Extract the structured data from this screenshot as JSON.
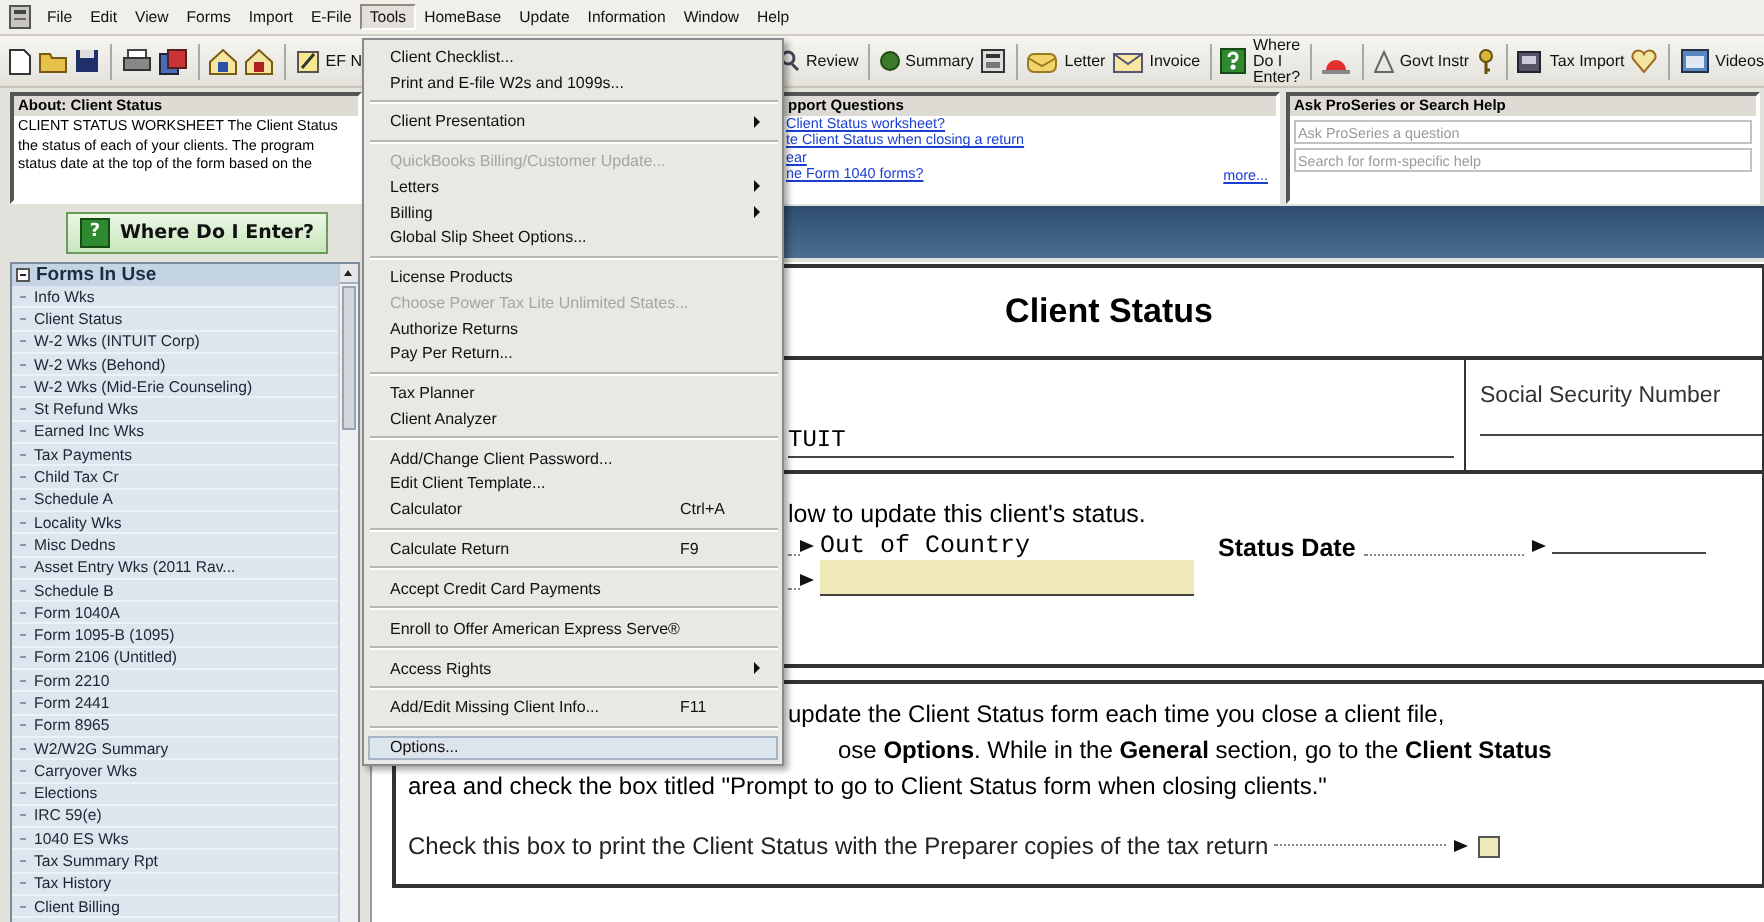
{
  "menu_bar": {
    "items": [
      {
        "label": "File",
        "selected": false
      },
      {
        "label": "Edit",
        "selected": false
      },
      {
        "label": "View",
        "selected": false
      },
      {
        "label": "Forms",
        "selected": false
      },
      {
        "label": "Import",
        "selected": false
      },
      {
        "label": "E-File",
        "selected": false
      },
      {
        "label": "Tools",
        "selected": true
      },
      {
        "label": "HomeBase",
        "selected": false
      },
      {
        "label": "Update",
        "selected": false
      },
      {
        "label": "Information",
        "selected": false
      },
      {
        "label": "Window",
        "selected": false
      },
      {
        "label": "Help",
        "selected": false
      }
    ]
  },
  "toolbar": {
    "buttons": [
      "EF N",
      "Review",
      "Summary",
      "Letter",
      "Invoice",
      "Where Do I Enter?",
      "Govt Instr",
      "Tax Import",
      "Videos"
    ]
  },
  "about_panel": {
    "title": "About: Client Status",
    "lines": [
      "CLIENT STATUS WORKSHEET The Client Status",
      "the status of each of your clients.  The program",
      "status date at the top of the form based on the"
    ]
  },
  "support_panel": {
    "title": "pport Questions",
    "links": [
      "Client Status worksheet?",
      "te Client Status when closing a return",
      "ear",
      "ne Form 1040 forms?"
    ],
    "more": "more..."
  },
  "search_panel": {
    "title": "Ask ProSeries or Search Help",
    "fields": [
      {
        "placeholder": "Ask ProSeries a question"
      },
      {
        "placeholder": "Search for form-specific help"
      }
    ]
  },
  "where_button": {
    "icon": "?",
    "label": "Where Do I Enter?"
  },
  "sidebar": {
    "title": "Forms In Use",
    "expanded": true,
    "items": [
      "Info Wks",
      "Client Status",
      "W-2 Wks (INTUIT Corp)",
      "W-2 Wks (Behond)",
      "W-2 Wks (Mid-Erie Counseling)",
      "St Refund Wks",
      "Earned Inc Wks",
      "Tax Payments",
      "Child Tax Cr",
      "Schedule A",
      "Locality Wks",
      "Misc Dedns",
      "Asset Entry Wks (2011 Rav...",
      "Schedule B",
      "Form 1040A",
      "Form 1095-B (1095)",
      "Form 2106 (Untitled)",
      "Form 2210",
      "Form 2441",
      "Form 8965",
      "W2/W2G Summary",
      "Carryover Wks",
      "Elections",
      "IRC 59(e)",
      "1040 ES Wks",
      "Tax Summary Rpt",
      "Tax History",
      "Client Billing"
    ]
  },
  "form": {
    "title": "Client Status",
    "name_value": "TUIT",
    "ssn_label": "Social Security Number",
    "instruction": "low to update this client's status.",
    "status_value": "Out of Country",
    "status_date_label": "Status Date",
    "note_lines": [
      "update the Client Status form each time you close a client file,",
      "ose **Options**. While in the **General** section, go to the **Client Status**",
      "area and check the box titled \"Prompt to go to Client Status form when closing clients.\""
    ],
    "print_checkbox": {
      "label": "Check this box to print the Client Status with the Preparer copies of the tax return",
      "checked": false
    }
  },
  "tools_menu": {
    "items": [
      {
        "kind": "item",
        "label": "Client Checklist...",
        "disabled": false,
        "submenu": false,
        "selected": false
      },
      {
        "kind": "item",
        "label": "Print and E-file W2s and 1099s...",
        "disabled": false,
        "submenu": false,
        "selected": false
      },
      {
        "kind": "separator"
      },
      {
        "kind": "item",
        "label": "Client Presentation",
        "disabled": false,
        "submenu": true,
        "selected": false
      },
      {
        "kind": "separator"
      },
      {
        "kind": "item",
        "label": "QuickBooks Billing/Customer Update...",
        "disabled": true,
        "submenu": false,
        "selected": false
      },
      {
        "kind": "item",
        "label": "Letters",
        "disabled": false,
        "submenu": true,
        "selected": false
      },
      {
        "kind": "item",
        "label": "Billing",
        "disabled": false,
        "submenu": true,
        "selected": false
      },
      {
        "kind": "item",
        "label": "Global Slip Sheet Options...",
        "disabled": false,
        "submenu": false,
        "selected": false
      },
      {
        "kind": "separator"
      },
      {
        "kind": "item",
        "label": "License Products",
        "disabled": false,
        "submenu": false,
        "selected": false
      },
      {
        "kind": "item",
        "label": "Choose Power Tax Lite Unlimited States...",
        "disabled": true,
        "submenu": false,
        "selected": false
      },
      {
        "kind": "item",
        "label": "Authorize Returns",
        "disabled": false,
        "submenu": false,
        "selected": false
      },
      {
        "kind": "item",
        "label": "Pay Per Return...",
        "disabled": false,
        "submenu": false,
        "selected": false
      },
      {
        "kind": "separator"
      },
      {
        "kind": "item",
        "label": "Tax Planner",
        "disabled": false,
        "submenu": false,
        "selected": false
      },
      {
        "kind": "item",
        "label": "Client Analyzer",
        "disabled": false,
        "submenu": false,
        "selected": false
      },
      {
        "kind": "separator"
      },
      {
        "kind": "item",
        "label": "Add/Change Client Password...",
        "disabled": false,
        "submenu": false,
        "selected": false
      },
      {
        "kind": "item",
        "label": "Edit Client Template...",
        "disabled": false,
        "submenu": false,
        "selected": false
      },
      {
        "kind": "item",
        "label": "Calculator",
        "shortcut": "Ctrl+A",
        "disabled": false,
        "submenu": false,
        "selected": false
      },
      {
        "kind": "separator"
      },
      {
        "kind": "item",
        "label": "Calculate Return",
        "shortcut": "F9",
        "disabled": false,
        "submenu": false,
        "selected": false
      },
      {
        "kind": "separator"
      },
      {
        "kind": "item",
        "label": "Accept Credit Card Payments",
        "disabled": false,
        "submenu": false,
        "selected": false
      },
      {
        "kind": "separator"
      },
      {
        "kind": "item",
        "label": "Enroll to Offer American Express Serve®",
        "disabled": false,
        "submenu": false,
        "selected": false
      },
      {
        "kind": "separator"
      },
      {
        "kind": "item",
        "label": "Access Rights",
        "disabled": false,
        "submenu": true,
        "selected": false
      },
      {
        "kind": "separator"
      },
      {
        "kind": "item",
        "label": "Add/Edit Missing Client Info...",
        "shortcut": "F11",
        "disabled": false,
        "submenu": false,
        "selected": false
      },
      {
        "kind": "separator"
      },
      {
        "kind": "item",
        "label": "Options...",
        "disabled": false,
        "submenu": false,
        "selected": true
      }
    ]
  }
}
